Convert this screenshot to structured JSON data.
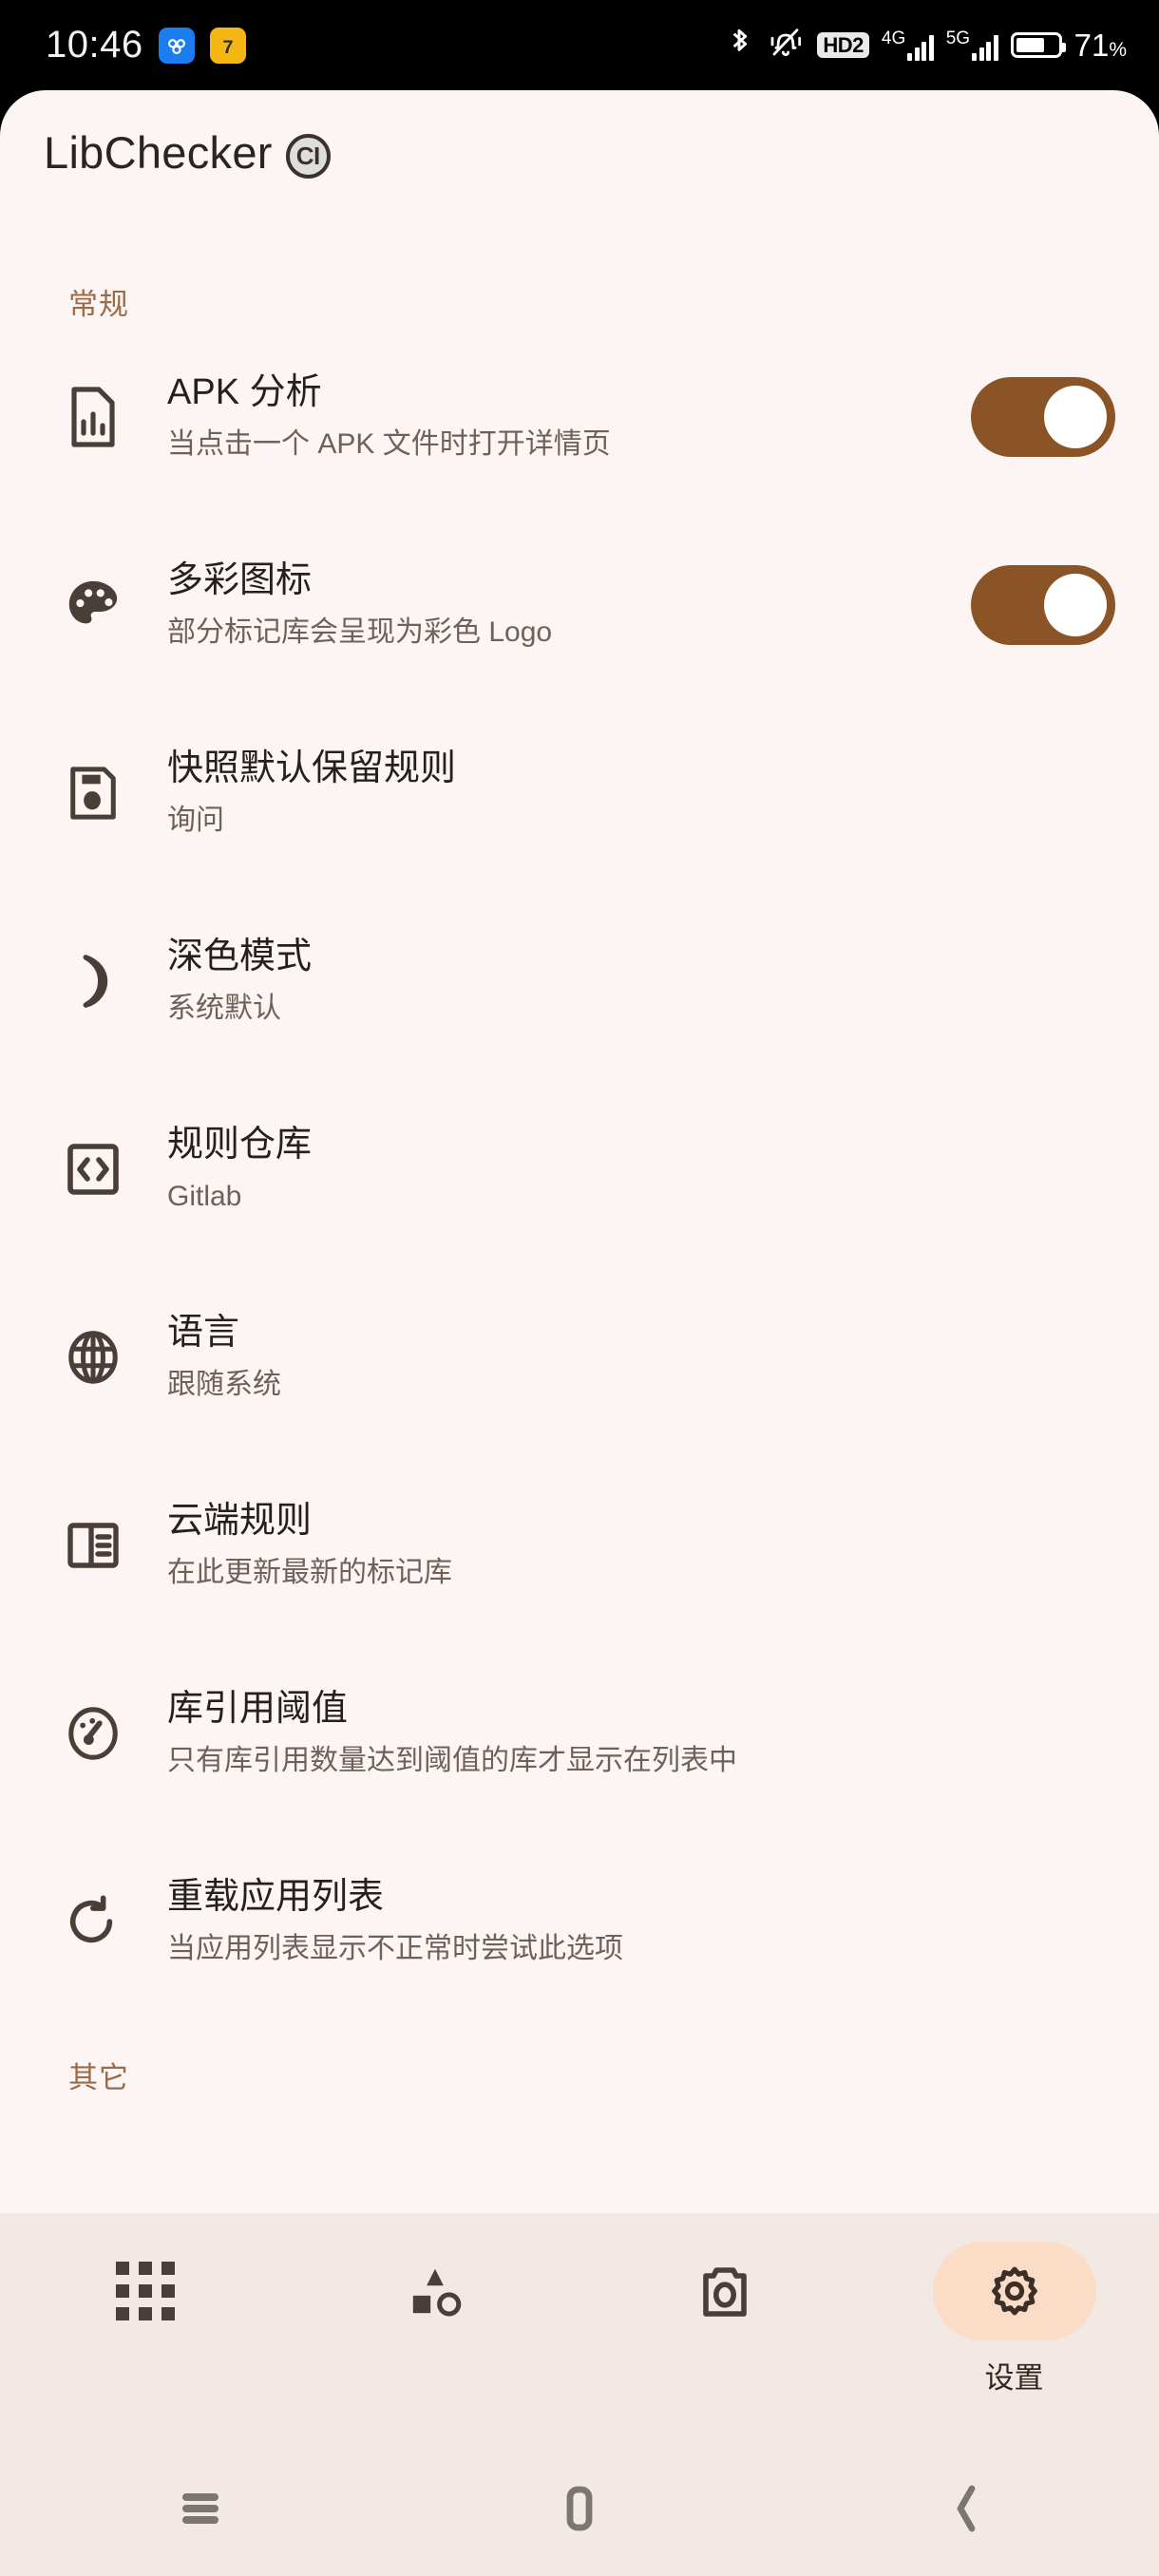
{
  "status_bar": {
    "time": "10:46",
    "app_icons": [
      "cloud-sync-icon",
      "parking-icon"
    ],
    "icons": [
      "bluetooth-icon",
      "silent-bell-icon",
      "hd2-badge",
      "signal-4g",
      "signal-5g",
      "battery-icon"
    ],
    "hd_label": "HD2",
    "net_4g": "4G",
    "net_5g": "5G",
    "battery_percent": "71",
    "battery_percent_symbol": "%"
  },
  "app_bar": {
    "title": "LibChecker",
    "badge": "CI"
  },
  "sections": [
    {
      "header": "常规",
      "items": [
        {
          "icon": "apk-file-chart-icon",
          "title": "APK 分析",
          "subtitle": "当点击一个 APK 文件时打开详情页",
          "control": "switch",
          "switch_on": true
        },
        {
          "icon": "palette-icon",
          "title": "多彩图标",
          "subtitle": "部分标记库会呈现为彩色 Logo",
          "control": "switch",
          "switch_on": true
        },
        {
          "icon": "save-disk-icon",
          "title": "快照默认保留规则",
          "subtitle": "询问",
          "control": "none"
        },
        {
          "icon": "moon-icon",
          "title": "深色模式",
          "subtitle": "系统默认",
          "control": "none"
        },
        {
          "icon": "code-brackets-icon",
          "title": "规则仓库",
          "subtitle": "Gitlab",
          "control": "none"
        },
        {
          "icon": "globe-icon",
          "title": "语言",
          "subtitle": "跟随系统",
          "control": "none"
        },
        {
          "icon": "cloud-rules-panel-icon",
          "title": "云端规则",
          "subtitle": "在此更新最新的标记库",
          "control": "none"
        },
        {
          "icon": "gauge-icon",
          "title": "库引用阈值",
          "subtitle": "只有库引用数量达到阈值的库才显示在列表中",
          "control": "none"
        },
        {
          "icon": "refresh-icon",
          "title": "重载应用列表",
          "subtitle": "当应用列表显示不正常时尝试此选项",
          "control": "none"
        }
      ]
    },
    {
      "header": "其它",
      "items": []
    }
  ],
  "bottom_nav": {
    "tabs": [
      {
        "icon": "apps-grid-icon",
        "label": "",
        "selected": false
      },
      {
        "icon": "shapes-icon",
        "label": "",
        "selected": false
      },
      {
        "icon": "camera-icon",
        "label": "",
        "selected": false
      },
      {
        "icon": "gear-icon",
        "label": "设置",
        "selected": true
      }
    ]
  },
  "system_nav": {
    "buttons": [
      "recents-icon",
      "home-icon",
      "back-icon"
    ]
  },
  "colors": {
    "page_bg": "#FDF5F3",
    "bottom_bar_bg": "#F2E8E4",
    "accent_switch": "#8A5426",
    "selected_pill": "#FBDCC6",
    "section_header": "#9b6b4a",
    "icon": "#4A3F38",
    "title_text": "#271f1b",
    "sub_text": "#6e6159"
  }
}
